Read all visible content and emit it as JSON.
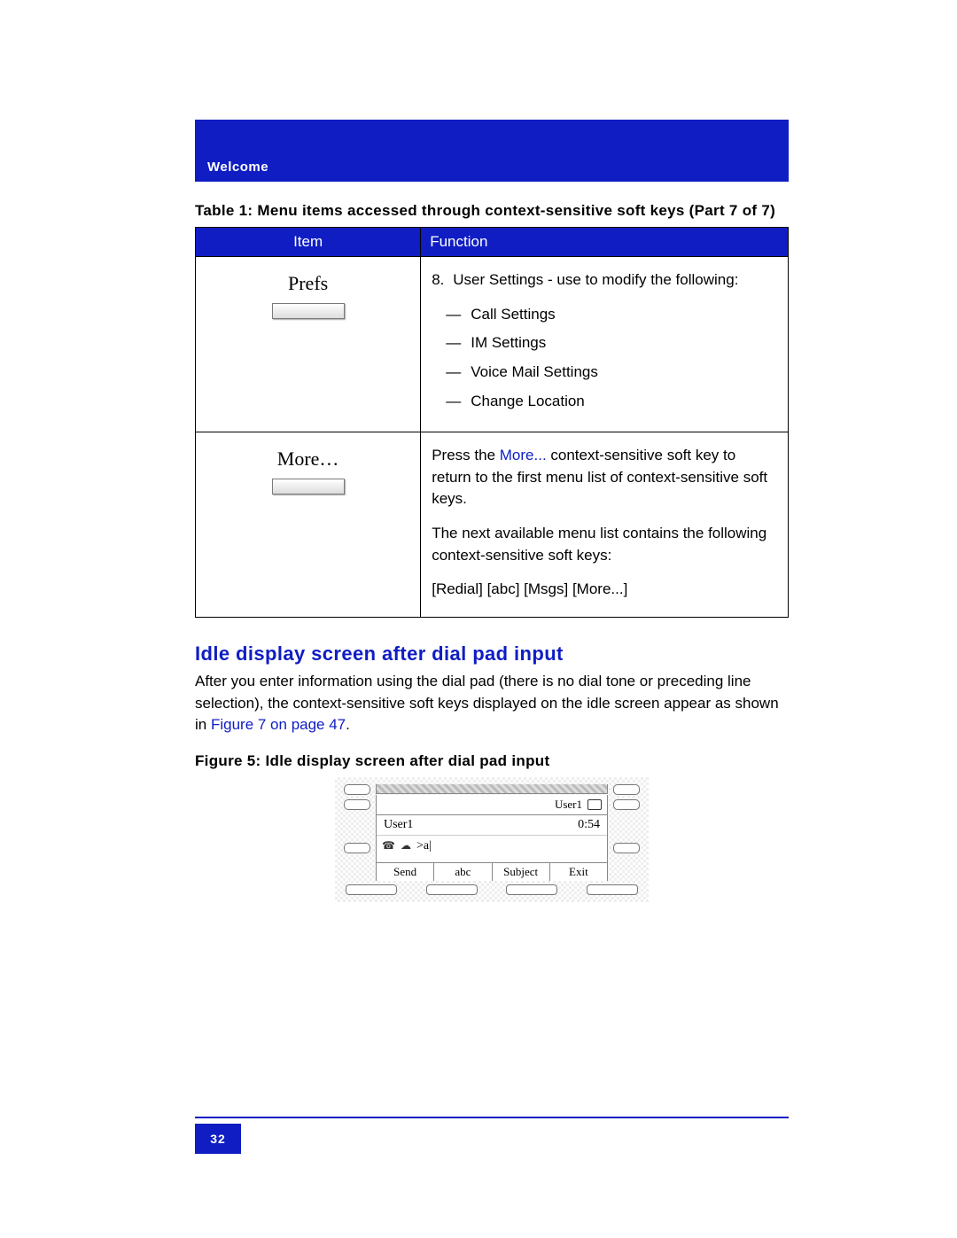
{
  "header": {
    "section": "Welcome"
  },
  "table": {
    "caption": "Table 1: Menu items accessed through context-sensitive soft keys (Part 7 of 7)",
    "headers": {
      "item": "Item",
      "function": "Function"
    },
    "rows": [
      {
        "item_label": "Prefs",
        "number": "8.",
        "lead": "User Settings - use to modify the following:",
        "bullets": [
          "Call Settings",
          "IM Settings",
          "Voice Mail Settings",
          "Change Location"
        ]
      },
      {
        "item_label": "More…",
        "para1_pre": "Press the ",
        "para1_link": "More...",
        "para1_post": " context-sensitive soft key to return to the first menu list of context-sensitive soft keys.",
        "para2": "The next available menu list contains the following context-sensitive soft keys:",
        "para3": "[Redial] [abc] [Msgs] [More...]"
      }
    ]
  },
  "section": {
    "heading": "Idle display screen after dial pad input",
    "para_pre": "After you enter information using the dial pad (there is no dial tone or preceding line selection), the context-sensitive soft keys displayed on the idle screen appear as shown in ",
    "para_link": "Figure 7 on page 47",
    "para_post": "."
  },
  "figure": {
    "caption": "Figure 5: Idle display screen after dial pad input",
    "status_user": "User1",
    "line1_left": "User1",
    "line1_right": "0:54",
    "input_text": ">a|",
    "softkeys": [
      "Send",
      "abc",
      "Subject",
      "Exit"
    ]
  },
  "page_number": "32"
}
